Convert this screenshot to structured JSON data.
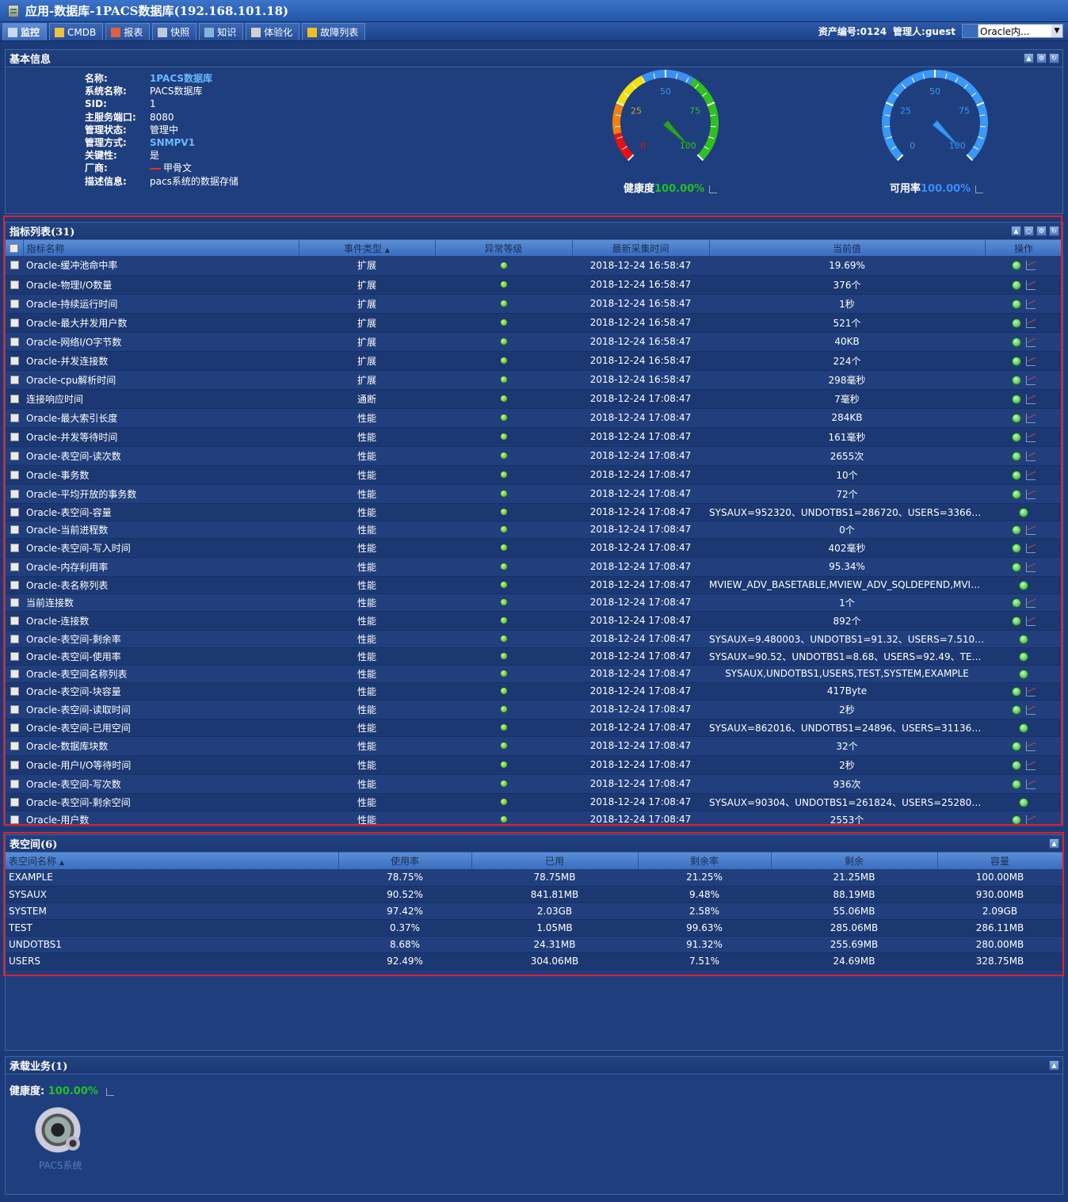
{
  "window": {
    "title": "应用-数据库-1PACS数据库(192.168.101.18)"
  },
  "tabs": [
    {
      "label": "监控",
      "icon": "monitor-icon",
      "active": true
    },
    {
      "label": "CMDB",
      "icon": "cmdb-icon"
    },
    {
      "label": "报表",
      "icon": "report-icon"
    },
    {
      "label": "快照",
      "icon": "snapshot-icon"
    },
    {
      "label": "知识",
      "icon": "knowledge-icon"
    },
    {
      "label": "体验化",
      "icon": "experience-icon"
    },
    {
      "label": "故障列表",
      "icon": "warning-icon"
    }
  ],
  "header_right": {
    "asset": "资产编号:0124",
    "admin": "管理人:guest",
    "select_value": "Oracle内..."
  },
  "basic": {
    "title": "基本信息",
    "rows": [
      {
        "label": "名称:",
        "value": "1PACS数据库",
        "style": "blue"
      },
      {
        "label": "系统名称:",
        "value": "PACS数据库"
      },
      {
        "label": "SID:",
        "value": "1"
      },
      {
        "label": "主服务端口:",
        "value": "8080"
      },
      {
        "label": "管理状态:",
        "value": "管理中"
      },
      {
        "label": "管理方式:",
        "value": "SNMPV1",
        "style": "blue"
      },
      {
        "label": "关键性:",
        "value": "是"
      },
      {
        "label": "厂商:",
        "value": "甲骨文"
      },
      {
        "label": "描述信息:",
        "value": "pacs系统的数据存储"
      }
    ],
    "gauges": [
      {
        "label": "健康度",
        "pct": "100.00%",
        "pct_color": "#22c022",
        "value": 100,
        "ticks": [
          "0",
          "25",
          "50",
          "75",
          "100"
        ]
      },
      {
        "label": "可用率",
        "pct": "100.00%",
        "pct_color": "#3a8cff",
        "value": 100,
        "ticks": [
          "0",
          "25",
          "50",
          "75",
          "100"
        ]
      }
    ]
  },
  "metrics": {
    "title": "指标列表(31)",
    "columns": [
      "指标名称",
      "事件类型",
      "异常等级",
      "最新采集时间",
      "当前值",
      "操作"
    ],
    "rows": [
      {
        "name": "Oracle-缓冲池命中率",
        "type": "扩展",
        "time": "2018-12-24 16:58:47",
        "value": "19.69%",
        "chart": true
      },
      {
        "name": "Oracle-物理I/O数量",
        "type": "扩展",
        "time": "2018-12-24 16:58:47",
        "value": "376个",
        "chart": true
      },
      {
        "name": "Oracle-持续运行时间",
        "type": "扩展",
        "time": "2018-12-24 16:58:47",
        "value": "1秒",
        "chart": true
      },
      {
        "name": "Oracle-最大并发用户数",
        "type": "扩展",
        "time": "2018-12-24 16:58:47",
        "value": "521个",
        "chart": true
      },
      {
        "name": "Oracle-网络I/O字节数",
        "type": "扩展",
        "time": "2018-12-24 16:58:47",
        "value": "40KB",
        "chart": true
      },
      {
        "name": "Oracle-并发连接数",
        "type": "扩展",
        "time": "2018-12-24 16:58:47",
        "value": "224个",
        "chart": true
      },
      {
        "name": "Oracle-cpu解析时间",
        "type": "扩展",
        "time": "2018-12-24 16:58:47",
        "value": "298毫秒",
        "chart": true
      },
      {
        "name": "连接响应时间",
        "type": "通断",
        "time": "2018-12-24 17:08:47",
        "value": "7毫秒",
        "chart": true
      },
      {
        "name": "Oracle-最大索引长度",
        "type": "性能",
        "time": "2018-12-24 17:08:47",
        "value": "284KB",
        "chart": true
      },
      {
        "name": "Oracle-并发等待时间",
        "type": "性能",
        "time": "2018-12-24 17:08:47",
        "value": "161毫秒",
        "chart": true
      },
      {
        "name": "Oracle-表空间-读次数",
        "type": "性能",
        "time": "2018-12-24 17:08:47",
        "value": "2655次",
        "chart": true
      },
      {
        "name": "Oracle-事务数",
        "type": "性能",
        "time": "2018-12-24 17:08:47",
        "value": "10个",
        "chart": true
      },
      {
        "name": "Oracle-平均开放的事务数",
        "type": "性能",
        "time": "2018-12-24 17:08:47",
        "value": "72个",
        "chart": true
      },
      {
        "name": "Oracle-表空间-容量",
        "type": "性能",
        "time": "2018-12-24 17:08:47",
        "value": "SYSAUX=952320、UNDOTBS1=286720、USERS=336640...",
        "chart": false
      },
      {
        "name": "Oracle-当前进程数",
        "type": "性能",
        "time": "2018-12-24 17:08:47",
        "value": "0个",
        "chart": true
      },
      {
        "name": "Oracle-表空间-写入时间",
        "type": "性能",
        "time": "2018-12-24 17:08:47",
        "value": "402毫秒",
        "chart": true
      },
      {
        "name": "Oracle-内存利用率",
        "type": "性能",
        "time": "2018-12-24 17:08:47",
        "value": "95.34%",
        "chart": true
      },
      {
        "name": "Oracle-表名称列表",
        "type": "性能",
        "time": "2018-12-24 17:08:47",
        "value": "MVIEW_ADV_BASETABLE,MVIEW_ADV_SQLDEPEND,MVIE...",
        "chart": false
      },
      {
        "name": "当前连接数",
        "type": "性能",
        "time": "2018-12-24 17:08:47",
        "value": "1个",
        "chart": true
      },
      {
        "name": "Oracle-连接数",
        "type": "性能",
        "time": "2018-12-24 17:08:47",
        "value": "892个",
        "chart": true
      },
      {
        "name": "Oracle-表空间-剩余率",
        "type": "性能",
        "time": "2018-12-24 17:08:47",
        "value": "SYSAUX=9.480003、UNDOTBS1=91.32、USERS=7.51000...",
        "chart": false
      },
      {
        "name": "Oracle-表空间-使用率",
        "type": "性能",
        "time": "2018-12-24 17:08:47",
        "value": "SYSAUX=90.52、UNDOTBS1=8.68、USERS=92.49、TEST...",
        "chart": false
      },
      {
        "name": "Oracle-表空间名称列表",
        "type": "性能",
        "time": "2018-12-24 17:08:47",
        "value": "SYSAUX,UNDOTBS1,USERS,TEST,SYSTEM,EXAMPLE",
        "chart": false
      },
      {
        "name": "Oracle-表空间-块容量",
        "type": "性能",
        "time": "2018-12-24 17:08:47",
        "value": "417Byte",
        "chart": true
      },
      {
        "name": "Oracle-表空间-读取时间",
        "type": "性能",
        "time": "2018-12-24 17:08:47",
        "value": "2秒",
        "chart": true
      },
      {
        "name": "Oracle-表空间-已用空间",
        "type": "性能",
        "time": "2018-12-24 17:08:47",
        "value": "SYSAUX=862016、UNDOTBS1=24896、USERS=311360...",
        "chart": false
      },
      {
        "name": "Oracle-数据库块数",
        "type": "性能",
        "time": "2018-12-24 17:08:47",
        "value": "32个",
        "chart": true
      },
      {
        "name": "Oracle-用户I/O等待时间",
        "type": "性能",
        "time": "2018-12-24 17:08:47",
        "value": "2秒",
        "chart": true
      },
      {
        "name": "Oracle-表空间-写次数",
        "type": "性能",
        "time": "2018-12-24 17:08:47",
        "value": "936次",
        "chart": true
      },
      {
        "name": "Oracle-表空间-剩余空间",
        "type": "性能",
        "time": "2018-12-24 17:08:47",
        "value": "SYSAUX=90304、UNDOTBS1=261824、USERS=25280、...",
        "chart": false
      },
      {
        "name": "Oracle-用户数",
        "type": "性能",
        "time": "2018-12-24 17:08:47",
        "value": "2553个",
        "chart": true
      }
    ]
  },
  "tablespace": {
    "title": "表空间(6)",
    "columns": [
      "表空间名称",
      "使用率",
      "已用",
      "剩余率",
      "剩余",
      "容量"
    ],
    "rows": [
      [
        "EXAMPLE",
        "78.75%",
        "78.75MB",
        "21.25%",
        "21.25MB",
        "100.00MB"
      ],
      [
        "SYSAUX",
        "90.52%",
        "841.81MB",
        "9.48%",
        "88.19MB",
        "930.00MB"
      ],
      [
        "SYSTEM",
        "97.42%",
        "2.03GB",
        "2.58%",
        "55.06MB",
        "2.09GB"
      ],
      [
        "TEST",
        "0.37%",
        "1.05MB",
        "99.63%",
        "285.06MB",
        "286.11MB"
      ],
      [
        "UNDOTBS1",
        "8.68%",
        "24.31MB",
        "91.32%",
        "255.69MB",
        "280.00MB"
      ],
      [
        "USERS",
        "92.49%",
        "304.06MB",
        "7.51%",
        "24.69MB",
        "328.75MB"
      ]
    ]
  },
  "business": {
    "title": "承载业务(1)",
    "health_label": "健康度:",
    "health_pct": "100.00%",
    "item_name": "PACS系统",
    "item_icon": "gear-icon"
  }
}
